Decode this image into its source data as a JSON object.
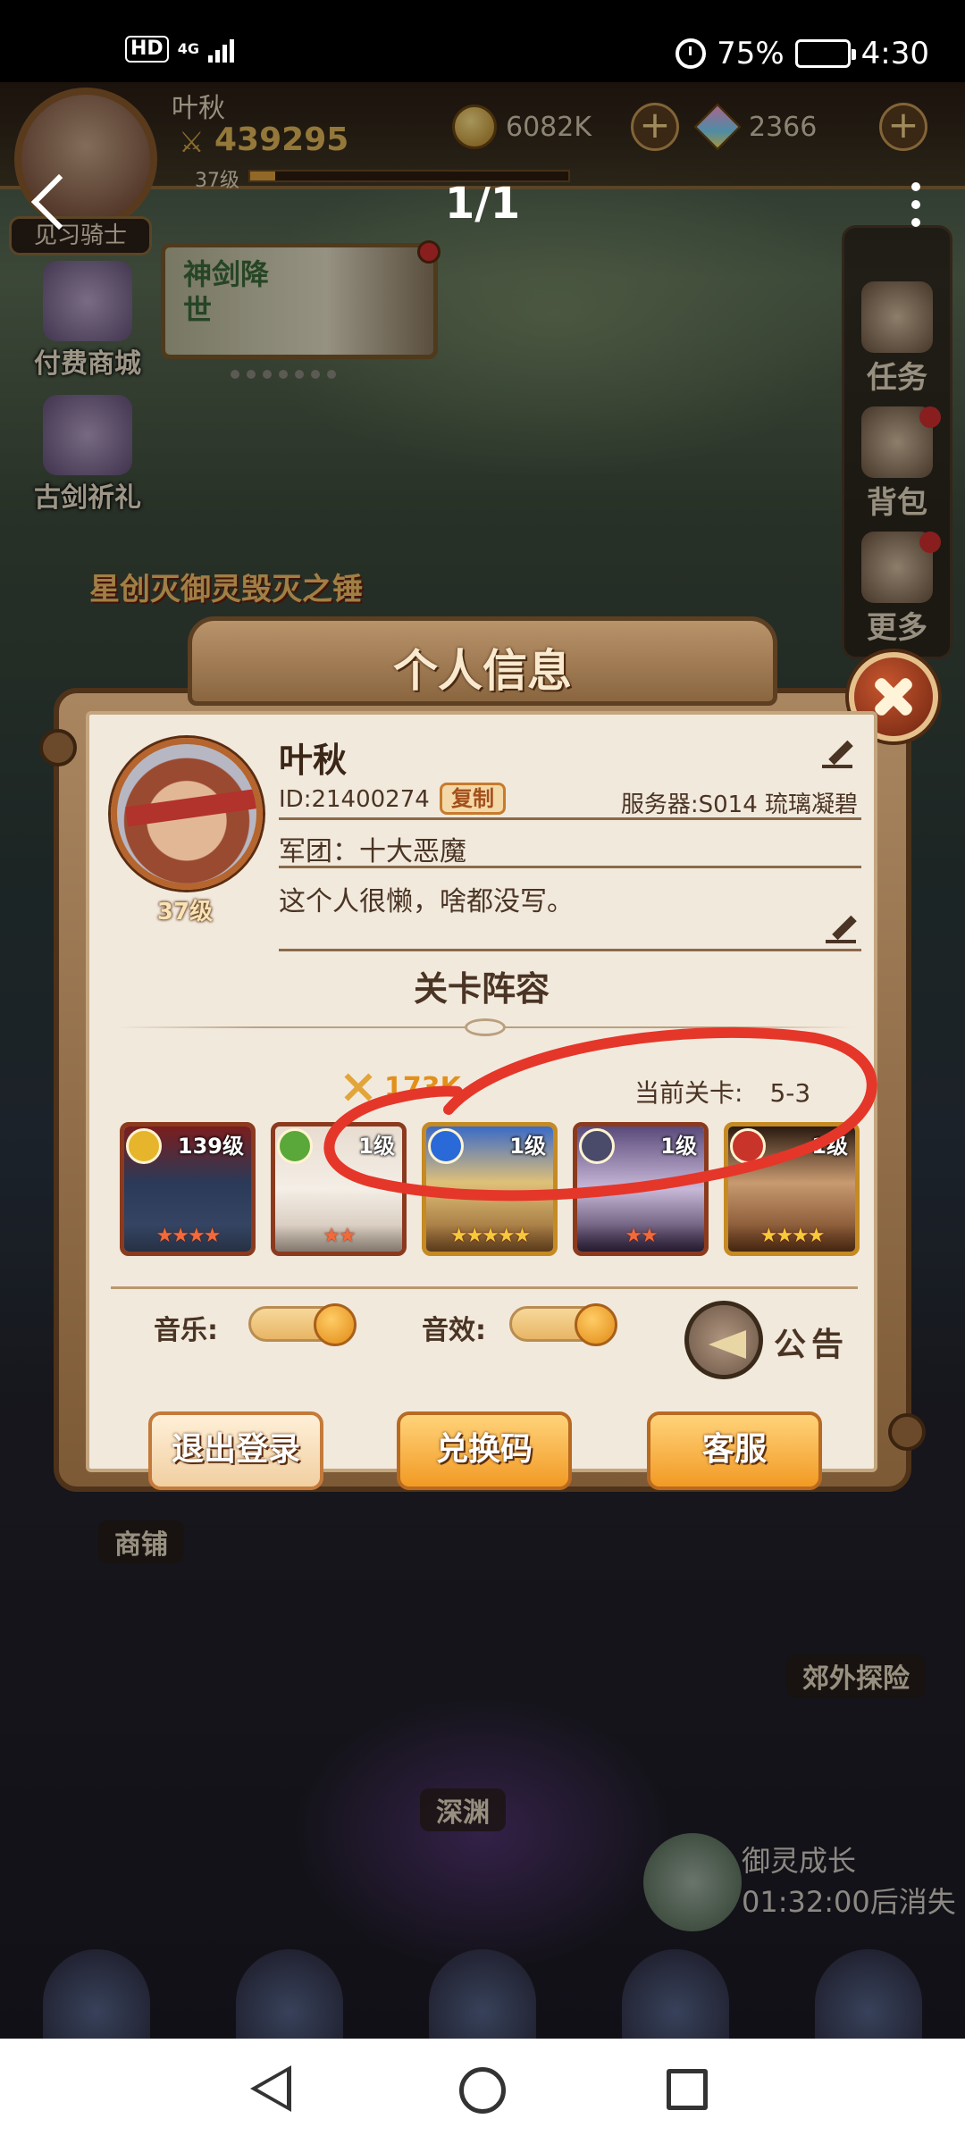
{
  "status_bar": {
    "left_badge": "HD",
    "network": "4G",
    "battery_percent": "75%",
    "battery_level": 0.75,
    "time": "4:30"
  },
  "viewer": {
    "page_counter": "1/1"
  },
  "hud": {
    "player_name": "叶秋",
    "power": "439295",
    "level": "37级",
    "xp_fraction": 0.08,
    "gold": "6082K",
    "gems": "2366",
    "rank": "见习骑士"
  },
  "left_menu": [
    {
      "label": "付费商城"
    },
    {
      "label": "古剑祈礼"
    }
  ],
  "banner": {
    "label": "神剑降世"
  },
  "right_menu": [
    {
      "label": "任务"
    },
    {
      "label": "背包"
    },
    {
      "label": "更多"
    }
  ],
  "event_title": "星创灭御灵毁灭之锤",
  "bottom": {
    "shop_label": "商铺",
    "abyss_label": "深渊",
    "explore_label": "郊外探险",
    "growth_title": "御灵成长",
    "growth_timer": "01:32:00后消失"
  },
  "profile": {
    "title": "个人信息",
    "name": "叶秋",
    "id": "ID:21400274",
    "copy_label": "复制",
    "server": "服务器:S014 琉璃凝碧",
    "guild": "军团：十大恶魔",
    "bio": "这个人很懒，啥都没写。",
    "level": "37级",
    "lineup_title": "关卡阵容",
    "lineup_power": "173K",
    "stage_label": "当前关卡:",
    "stage_value": "5-3",
    "heroes": [
      {
        "level": "139级",
        "stars": "★★★★",
        "element": "light",
        "star_color": "red"
      },
      {
        "level": "1级",
        "stars": "★★",
        "element": "wind",
        "star_color": "red"
      },
      {
        "level": "1级",
        "stars": "★★★★★",
        "element": "water",
        "star_color": "gold"
      },
      {
        "level": "1级",
        "stars": "★★",
        "element": "dark",
        "star_color": "red"
      },
      {
        "level": "1级",
        "stars": "★★★★",
        "element": "fire",
        "star_color": "gold"
      }
    ],
    "music_label": "音乐:",
    "sfx_label": "音效:",
    "music_on": true,
    "sfx_on": true,
    "announce_label": "公告",
    "buttons": {
      "logout": "退出登录",
      "redeem": "兑换码",
      "support": "客服"
    }
  },
  "colors": {
    "panel_bg": "#f2e9dd",
    "frame": "#7d5a36",
    "accent_orange": "#f29a24",
    "annotation_red": "#e5362a"
  }
}
